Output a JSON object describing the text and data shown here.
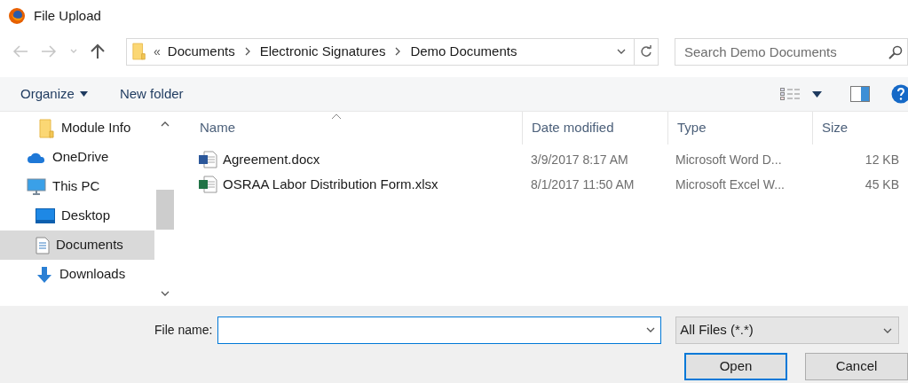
{
  "window": {
    "title": "File Upload"
  },
  "address_bar": {
    "overflow": "«",
    "path": [
      "Documents",
      "Electronic Signatures",
      "Demo Documents"
    ]
  },
  "search": {
    "placeholder": "Search Demo Documents"
  },
  "toolbar": {
    "organize": "Organize",
    "new_folder": "New folder"
  },
  "sidebar": {
    "items": [
      {
        "label": "Module Info",
        "kind": "folder",
        "selected": false
      },
      {
        "label": "OneDrive",
        "kind": "cloud",
        "selected": false
      },
      {
        "label": "This PC",
        "kind": "pc",
        "selected": false,
        "children": [
          {
            "label": "Desktop",
            "kind": "desktop",
            "selected": false
          },
          {
            "label": "Documents",
            "kind": "documents",
            "selected": true
          },
          {
            "label": "Downloads",
            "kind": "downloads",
            "selected": false
          }
        ]
      }
    ]
  },
  "table": {
    "columns": [
      "Name",
      "Date modified",
      "Type",
      "Size"
    ],
    "rows": [
      {
        "kind": "word",
        "name": "Agreement.docx",
        "date": "3/9/2017 8:17 AM",
        "type": "Microsoft Word D...",
        "size": "12 KB",
        "selected": false
      },
      {
        "kind": "excel",
        "name": "OSRAA Labor Distribution Form.xlsx",
        "date": "8/1/2017 11:50 AM",
        "type": "Microsoft Excel W...",
        "size": "45 KB",
        "selected": false
      }
    ]
  },
  "file_name": {
    "label": "File name:"
  },
  "file_type": {
    "value": "All Files (*.*)"
  },
  "buttons": [
    "Open",
    "Cancel"
  ]
}
